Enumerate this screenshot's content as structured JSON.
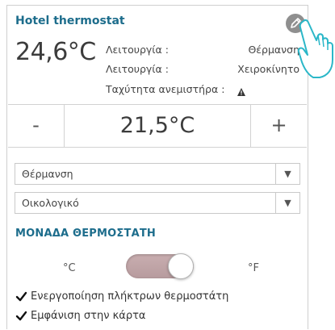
{
  "widget": {
    "title": "Hotel thermostat",
    "edit_icon": "pencil-icon",
    "current_temperature": "24,6°C",
    "info": [
      {
        "label": "Λειτουργία :",
        "value": "Θέρμανση"
      },
      {
        "label": "Λειτουργία :",
        "value": "Χειροκίνητο"
      },
      {
        "label": "Ταχύτητα ανεμιστήρα :",
        "value_icon": "warning-icon"
      }
    ],
    "stepper": {
      "minus": "-",
      "setpoint": "21,5°C",
      "plus": "+"
    },
    "mode_select": {
      "value": "Θέρμανση",
      "arrow": "▼"
    },
    "profile_select": {
      "value": "Οικολογικό",
      "arrow": "▼"
    }
  },
  "thermostat_unit": {
    "section_title": "ΜΟΝΑΔΑ ΘΕΡΜΟΣΤΑΤΗ",
    "unit_c": "°C",
    "unit_f": "°F",
    "toggle_state": "right"
  },
  "options": [
    {
      "label": "Ενεργοποίηση πλήκτρων θερμοστάτη",
      "checked": true
    },
    {
      "label": "Εμφάνιση στην κάρτα",
      "checked": true
    }
  ],
  "colors": {
    "accent": "#1d6d8c",
    "toggle_track": "#c2a6a9",
    "cursor": "#2bb7c8"
  }
}
